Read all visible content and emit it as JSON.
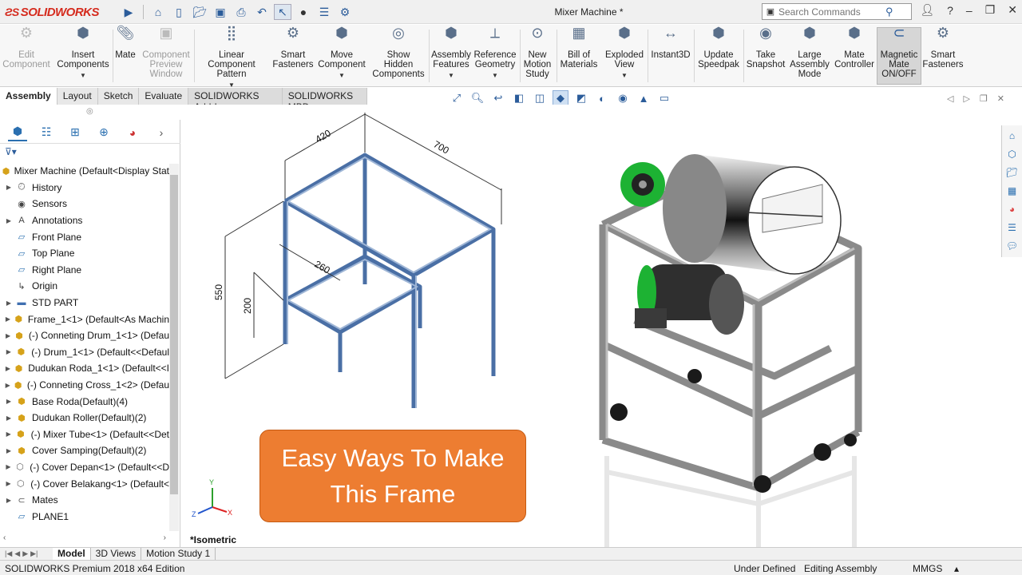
{
  "app": {
    "brand": "SOLIDWORKS",
    "doc_title": "Mixer Machine *"
  },
  "search": {
    "placeholder": "Search Commands"
  },
  "ribbon": [
    {
      "label": "Edit\nComponent",
      "disabled": true
    },
    {
      "label": "Insert\nComponents"
    },
    {
      "label": "Mate"
    },
    {
      "label": "Component\nPreview\nWindow",
      "disabled": true
    },
    {
      "label": "Linear Component\nPattern"
    },
    {
      "label": "Smart\nFasteners"
    },
    {
      "label": "Move\nComponent"
    },
    {
      "label": "Show\nHidden\nComponents"
    },
    {
      "label": "Assembly\nFeatures"
    },
    {
      "label": "Reference\nGeometry"
    },
    {
      "label": "New\nMotion\nStudy"
    },
    {
      "label": "Bill of\nMaterials"
    },
    {
      "label": "Exploded\nView"
    },
    {
      "label": "Instant3D"
    },
    {
      "label": "Update\nSpeedpak"
    },
    {
      "label": "Take\nSnapshot"
    },
    {
      "label": "Large\nAssembly\nMode"
    },
    {
      "label": "Mate\nController"
    },
    {
      "label": "Magnetic\nMate\nON/OFF",
      "active": true
    },
    {
      "label": "Smart\nFasteners"
    }
  ],
  "command_tabs": [
    "Assembly",
    "Layout",
    "Sketch",
    "Evaluate",
    "SOLIDWORKS Add-Ins",
    "SOLIDWORKS MBD"
  ],
  "tree": {
    "root": "Mixer Machine  (Default<Display Stat",
    "items": [
      {
        "label": "History",
        "expand": true,
        "icon": "history-icon"
      },
      {
        "label": "Sensors",
        "expand": false,
        "icon": "sensor-icon"
      },
      {
        "label": "Annotations",
        "expand": true,
        "icon": "annotation-icon"
      },
      {
        "label": "Front Plane",
        "expand": false,
        "icon": "plane-icon"
      },
      {
        "label": "Top Plane",
        "expand": false,
        "icon": "plane-icon"
      },
      {
        "label": "Right Plane",
        "expand": false,
        "icon": "plane-icon"
      },
      {
        "label": "Origin",
        "expand": false,
        "icon": "origin-icon"
      },
      {
        "label": "STD PART",
        "expand": true,
        "icon": "folder-icon"
      },
      {
        "label": "Frame_1<1> (Default<As Machin",
        "expand": true,
        "icon": "part-icon"
      },
      {
        "label": "(-) Conneting Drum_1<1> (Defau",
        "expand": true,
        "icon": "part-icon"
      },
      {
        "label": "(-) Drum_1<1> (Default<<Defaul",
        "expand": true,
        "icon": "part-icon"
      },
      {
        "label": "Dudukan Roda_1<1> (Default<<I",
        "expand": true,
        "icon": "part-icon"
      },
      {
        "label": "(-) Conneting Cross_1<2> (Defau",
        "expand": true,
        "icon": "part-icon"
      },
      {
        "label": "Base Roda(Default)(4)",
        "expand": true,
        "icon": "pattern-icon"
      },
      {
        "label": "Dudukan Roller(Default)(2)",
        "expand": true,
        "icon": "pattern-icon"
      },
      {
        "label": "(-) Mixer Tube<1> (Default<<Det",
        "expand": true,
        "icon": "part-icon"
      },
      {
        "label": "Cover Samping(Default)(2)",
        "expand": true,
        "icon": "pattern-icon"
      },
      {
        "label": "(-) Cover Depan<1> (Default<<D",
        "expand": true,
        "icon": "part-outline-icon"
      },
      {
        "label": "(-) Cover Belakang<1> (Default<",
        "expand": true,
        "icon": "part-outline-icon"
      },
      {
        "label": "Mates",
        "expand": true,
        "icon": "mates-icon"
      },
      {
        "label": "PLANE1",
        "expand": false,
        "icon": "plane-icon"
      }
    ]
  },
  "viewport": {
    "banner": "Easy Ways To Make\nThis Frame",
    "view_label": "*Isometric",
    "dims": {
      "d420": "420",
      "d700": "700",
      "d260": "260",
      "d550": "550",
      "d200": "200"
    },
    "triad": {
      "x": "X",
      "y": "Y",
      "z": "Z"
    }
  },
  "bottom_tabs": [
    "Model",
    "3D Views",
    "Motion Study 1"
  ],
  "status": {
    "edition": "SOLIDWORKS Premium 2018 x64 Edition",
    "defined": "Under Defined",
    "mode": "Editing Assembly",
    "units": "MMGS"
  }
}
